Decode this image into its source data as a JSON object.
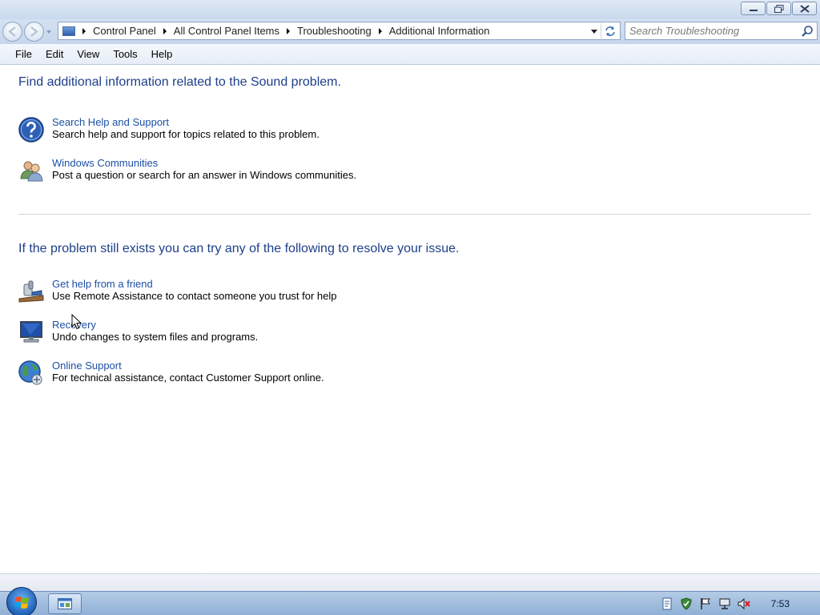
{
  "window": {
    "controls": {
      "minimize": "minimize-icon",
      "restore": "restore-icon",
      "close": "close-icon"
    }
  },
  "address": {
    "breadcrumbs": [
      "Control Panel",
      "All Control Panel Items",
      "Troubleshooting",
      "Additional Information"
    ]
  },
  "search": {
    "placeholder": "Search Troubleshooting"
  },
  "menu": [
    "File",
    "Edit",
    "View",
    "Tools",
    "Help"
  ],
  "sections": {
    "additional_info": {
      "heading": "Find additional information related to the Sound problem.",
      "tasks": [
        {
          "link": "Search Help and Support",
          "desc": "Search help and support for topics related to this problem.",
          "icon": "help-icon"
        },
        {
          "link": "Windows Communities",
          "desc": "Post a question or search for an answer in Windows communities.",
          "icon": "people-icon"
        }
      ]
    },
    "resolve": {
      "heading": "If the problem still exists you can try any of the following to resolve your issue.",
      "tasks": [
        {
          "link": "Get help from a friend",
          "desc": "Use Remote Assistance to contact someone you trust for help",
          "icon": "remote-assistance-icon"
        },
        {
          "link": "Recovery",
          "desc": "Undo changes to system files and programs.",
          "icon": "recovery-icon"
        },
        {
          "link": "Online Support",
          "desc": "For technical assistance, contact Customer Support online.",
          "icon": "globe-icon"
        }
      ]
    }
  },
  "taskbar": {
    "clock": "7:53"
  },
  "colors": {
    "link": "#1c4fa5",
    "heading": "#1e3f8a"
  }
}
